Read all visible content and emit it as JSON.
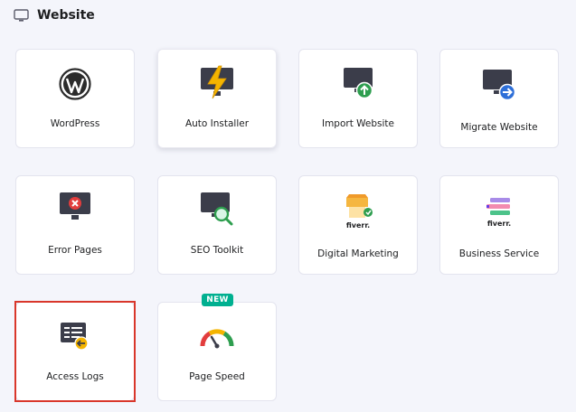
{
  "header": {
    "title": "Website",
    "icon": "monitor-icon"
  },
  "tiles": [
    {
      "label": "WordPress",
      "icon": "wordpress-icon"
    },
    {
      "label": "Auto Installer",
      "icon": "auto-installer-icon"
    },
    {
      "label": "Import Website",
      "icon": "import-website-icon"
    },
    {
      "label": "Migrate Website",
      "icon": "migrate-website-icon"
    },
    {
      "label": "Error Pages",
      "icon": "error-pages-icon"
    },
    {
      "label": "SEO Toolkit",
      "icon": "seo-toolkit-icon"
    },
    {
      "label": "Digital Marketing",
      "icon": "fiverr-digital-marketing-icon",
      "logo_text": "fiverr."
    },
    {
      "label": "Business Service",
      "icon": "fiverr-business-service-icon",
      "logo_text": "fiverr."
    },
    {
      "label": "Access Logs",
      "icon": "access-logs-icon",
      "highlighted": true
    },
    {
      "label": "Page Speed",
      "icon": "page-speed-icon",
      "badge": "NEW"
    }
  ],
  "colors": {
    "accent": "#673de6",
    "badge": "#00b090",
    "highlight_border": "#d9372b",
    "card_background": "#ffffff",
    "page_background": "#f4f5fb"
  }
}
